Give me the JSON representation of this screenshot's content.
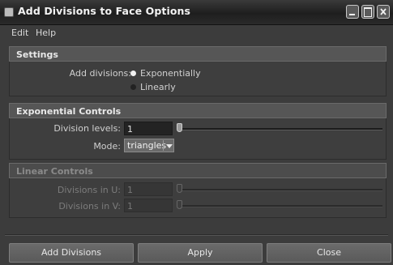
{
  "window": {
    "title": "Add Divisions to Face Options"
  },
  "menubar": {
    "items": [
      "Edit",
      "Help"
    ]
  },
  "settings": {
    "header": "Settings",
    "add_divisions_label": "Add divisions:",
    "options": [
      {
        "label": "Exponentially",
        "selected": true
      },
      {
        "label": "Linearly",
        "selected": false
      }
    ]
  },
  "exponential": {
    "header": "Exponential Controls",
    "division_levels_label": "Division levels:",
    "division_levels_value": "1",
    "division_levels_slider_fraction": 0.0,
    "mode_label": "Mode:",
    "mode_value": "triangles"
  },
  "linear": {
    "header": "Linear Controls",
    "enabled": false,
    "divisions_u_label": "Divisions in U:",
    "divisions_u_value": "1",
    "divisions_u_slider_fraction": 0.0,
    "divisions_v_label": "Divisions in V:",
    "divisions_v_value": "1",
    "divisions_v_slider_fraction": 0.0
  },
  "buttons": {
    "add_divisions": "Add Divisions",
    "apply": "Apply",
    "close": "Close"
  },
  "icons": {
    "app": "maya-app-icon",
    "minimize": "minimize-icon",
    "maximize": "maximize-icon",
    "close": "close-icon"
  }
}
